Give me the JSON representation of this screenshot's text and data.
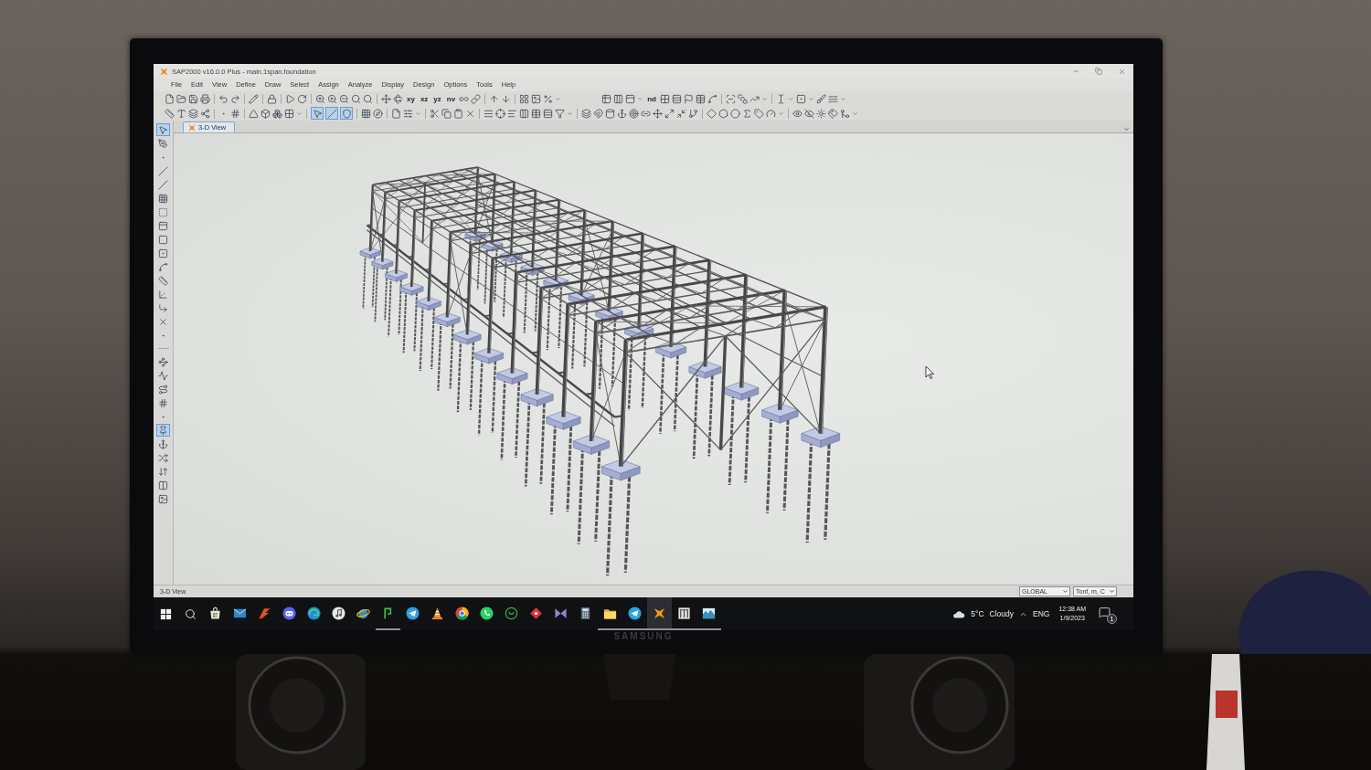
{
  "window": {
    "title": "SAP2000 v16.0.0 Plus - main.1span.foundation"
  },
  "menu": [
    "File",
    "Edit",
    "View",
    "Define",
    "Draw",
    "Select",
    "Assign",
    "Analyze",
    "Display",
    "Design",
    "Options",
    "Tools",
    "Help"
  ],
  "toolbar": {
    "plane_buttons": [
      "xy",
      "xz",
      "yz",
      "nv"
    ],
    "text_button": "nd",
    "selection_toggles": [
      {
        "selected": true
      },
      {
        "selected": true
      },
      {
        "selected": true
      }
    ]
  },
  "tabs": [
    {
      "label": "3-D View",
      "selected": true
    }
  ],
  "left_toolbar": [
    {
      "selected": true
    },
    {
      "selected": false
    },
    {
      "selected": false
    },
    {
      "selected": false
    },
    {
      "selected": false
    },
    {
      "selected": false
    },
    {
      "selected": false
    },
    {
      "selected": false
    },
    {
      "selected": false
    },
    {
      "selected": false
    },
    {
      "selected": false
    },
    {
      "selected": false
    },
    {
      "selected": false
    },
    {
      "selected": false
    },
    {
      "selected": false
    },
    {
      "selected": false
    },
    {
      "selected": false
    },
    {
      "selected": false
    },
    {
      "selected": false
    },
    {
      "selected": false
    },
    {
      "selected": false
    },
    {
      "selected": true
    },
    {
      "selected": false
    },
    {
      "selected": false
    },
    {
      "selected": false
    },
    {
      "selected": false
    },
    {
      "selected": false
    }
  ],
  "status_bar": {
    "view_name": "3-D View",
    "coordinate_system": "GLOBAL",
    "units": "Tonf, m, C"
  },
  "taskbar": {
    "apps": [
      {
        "running": false,
        "selected": false
      },
      {
        "running": false,
        "selected": false
      },
      {
        "running": false,
        "selected": false
      },
      {
        "running": false,
        "selected": false
      },
      {
        "running": false,
        "selected": false
      },
      {
        "running": false,
        "selected": false
      },
      {
        "running": false,
        "selected": false
      },
      {
        "running": true,
        "selected": false
      },
      {
        "running": false,
        "selected": false
      },
      {
        "running": false,
        "selected": false
      },
      {
        "running": false,
        "selected": false
      },
      {
        "running": false,
        "selected": false
      },
      {
        "running": false,
        "selected": false
      },
      {
        "running": false,
        "selected": false
      },
      {
        "running": false,
        "selected": false
      },
      {
        "running": false,
        "selected": false
      },
      {
        "running": true,
        "selected": false
      },
      {
        "running": true,
        "selected": false
      },
      {
        "running": true,
        "selected": true
      },
      {
        "running": true,
        "selected": false
      },
      {
        "running": true,
        "selected": false
      }
    ],
    "weather": {
      "temperature": "5°C",
      "condition": "Cloudy"
    },
    "language": "ENG",
    "time": "12:38 AM",
    "date": "1/9/2023",
    "notification_count": "1"
  },
  "monitor": {
    "brand": "SAMSUNG"
  }
}
